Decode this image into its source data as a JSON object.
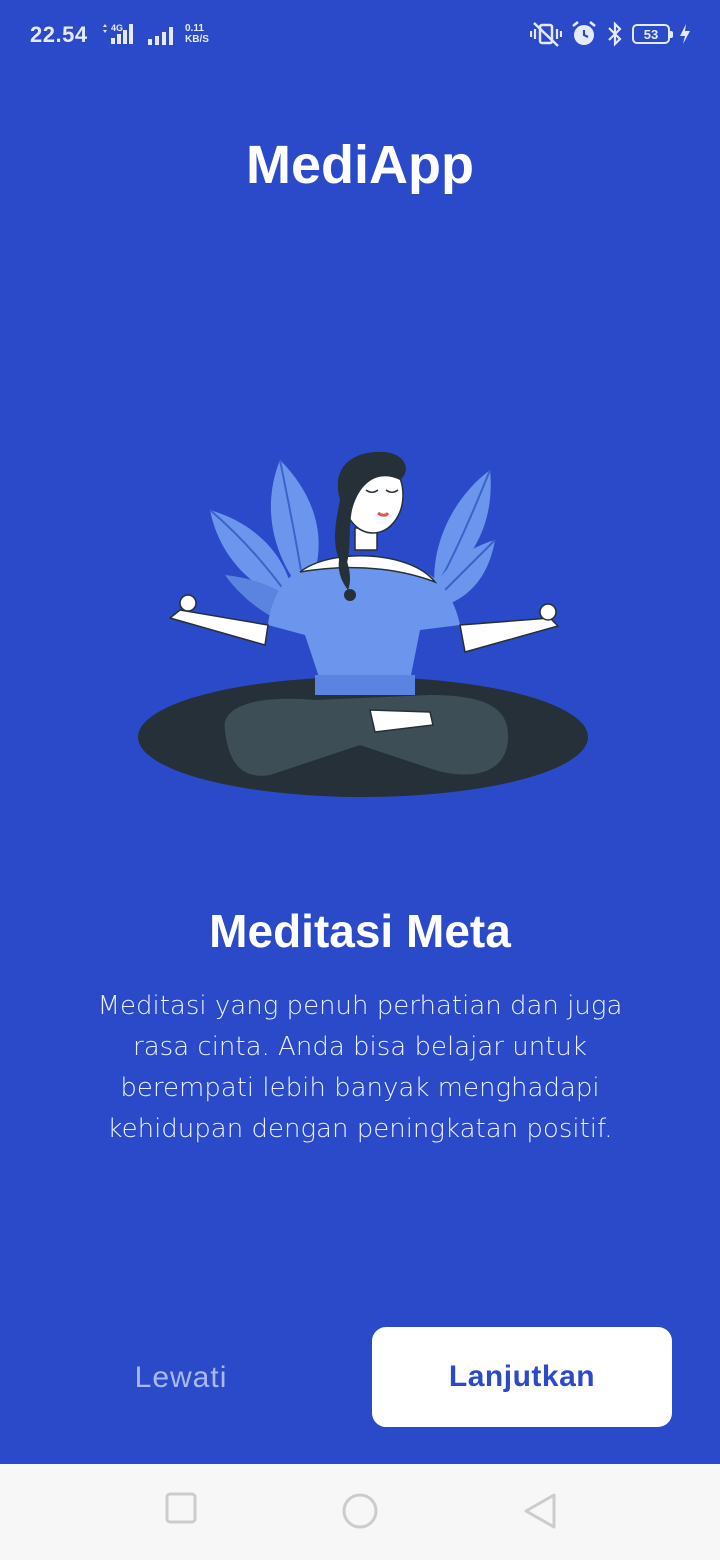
{
  "status_bar": {
    "time": "22.54",
    "network_type": "4G",
    "net_speed_value": "0.11",
    "net_speed_unit": "KB/S",
    "battery_level": "53"
  },
  "app": {
    "title": "MediApp"
  },
  "onboarding": {
    "headline": "Meditasi Meta",
    "description": "Meditasi yang penuh perhatian dan juga rasa cinta. Anda bisa belajar untuk berempati lebih banyak menghadapi kehidupan dengan peningkatan positif.",
    "illustration": "woman-meditating-illustration"
  },
  "actions": {
    "skip_label": "Lewati",
    "continue_label": "Lanjutkan"
  },
  "nav": {
    "icons": [
      "recent-apps-icon",
      "home-icon",
      "back-icon"
    ]
  },
  "colors": {
    "background": "#2A4AC9",
    "button_bg": "#FFFFFF",
    "button_text": "#2A4AC9",
    "skip_text": "#A9B8F0"
  }
}
